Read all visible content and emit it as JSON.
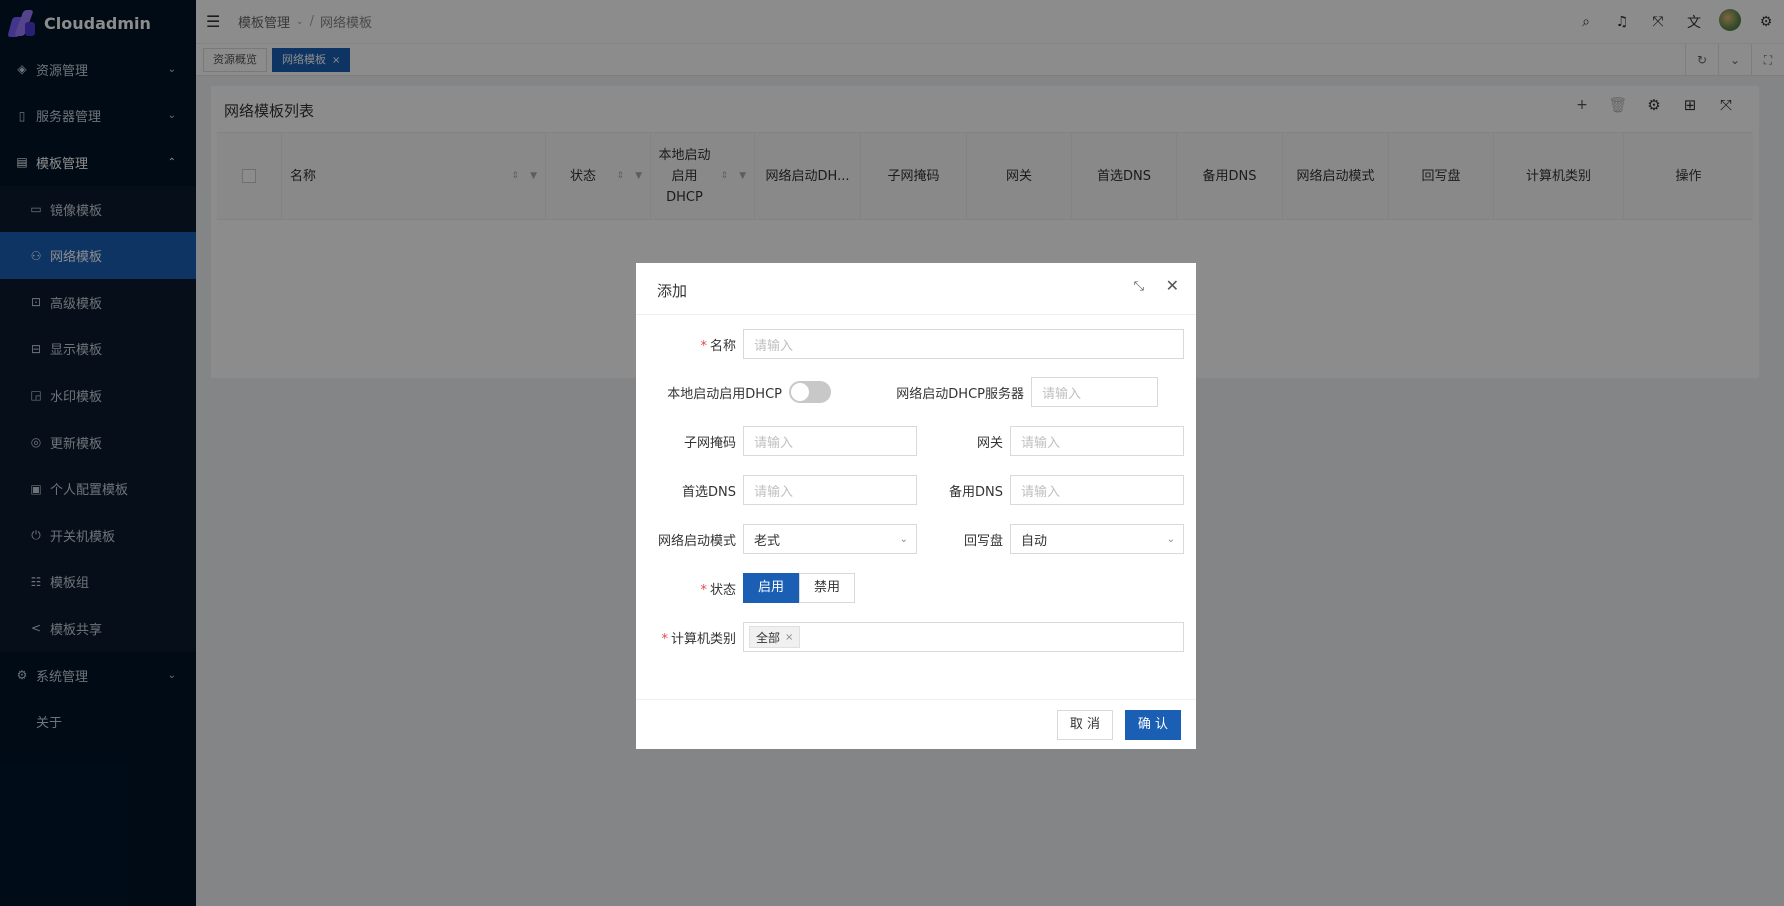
{
  "app": {
    "name": "Cloudadmin"
  },
  "sidebar": {
    "items": [
      {
        "label": "资源管理",
        "icon": "diamond-icon",
        "arrow": "⌄"
      },
      {
        "label": "服务器管理",
        "icon": "server-icon",
        "arrow": "⌄"
      },
      {
        "label": "模板管理",
        "icon": "template-icon",
        "arrow": "⌃"
      }
    ],
    "sub_items": [
      {
        "label": "镜像模板",
        "icon": "disk-icon"
      },
      {
        "label": "网络模板",
        "icon": "network-icon"
      },
      {
        "label": "高级模板",
        "icon": "advanced-icon"
      },
      {
        "label": "显示模板",
        "icon": "display-icon"
      },
      {
        "label": "水印模板",
        "icon": "watermark-icon"
      },
      {
        "label": "更新模板",
        "icon": "update-icon"
      },
      {
        "label": "个人配置模板",
        "icon": "profile-icon"
      },
      {
        "label": "开关机模板",
        "icon": "power-icon"
      },
      {
        "label": "模板组",
        "icon": "group-icon"
      },
      {
        "label": "模板共享",
        "icon": "share-icon"
      }
    ],
    "system": {
      "label": "系统管理",
      "icon": "gear-icon",
      "arrow": "⌄"
    },
    "about": {
      "label": "关于"
    }
  },
  "header": {
    "breadcrumb": {
      "parent": "模板管理",
      "separator": "/",
      "current": "网络模板"
    }
  },
  "tabs": [
    {
      "label": "资源概览"
    },
    {
      "label": "网络模板",
      "close": "×"
    }
  ],
  "card": {
    "title": "网络模板列表",
    "columns": [
      "名称",
      "状态",
      "本地启动启用DHCP",
      "网络启动DH...",
      "子网掩码",
      "网关",
      "首选DNS",
      "备用DNS",
      "网络启动模式",
      "回写盘",
      "计算机类别",
      "操作"
    ]
  },
  "modal": {
    "title": "添加",
    "placeholder": "请输入",
    "fields": {
      "name": {
        "label": "名称"
      },
      "local_dhcp": {
        "label": "本地启动启用DHCP",
        "value": "off"
      },
      "net_dhcp_server": {
        "label": "网络启动DHCP服务器"
      },
      "subnet": {
        "label": "子网掩码"
      },
      "gateway": {
        "label": "网关"
      },
      "dns1": {
        "label": "首选DNS"
      },
      "dns2": {
        "label": "备用DNS"
      },
      "boot_mode": {
        "label": "网络启动模式",
        "value": "老式"
      },
      "writeback": {
        "label": "回写盘",
        "value": "自动"
      },
      "status": {
        "label": "状态",
        "options": [
          "启用",
          "禁用"
        ],
        "selected": "启用"
      },
      "category": {
        "label": "计算机类别",
        "tags": [
          "全部"
        ]
      }
    },
    "cancel": "取 消",
    "confirm": "确 认"
  },
  "colors": {
    "primary": "#1a5fb4",
    "sidebar_bg": "#001529",
    "required": "#e84545"
  }
}
